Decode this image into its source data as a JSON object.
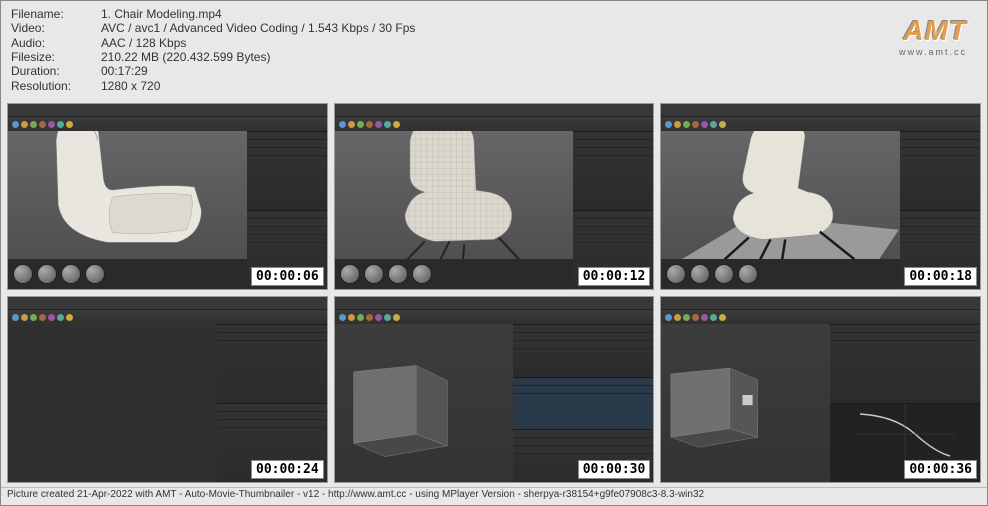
{
  "meta": {
    "filename_label": "Filename:",
    "filename": "1. Chair Modeling.mp4",
    "video_label": "Video:",
    "video": "AVC / avc1 / Advanced Video Coding / 1.543 Kbps / 30 Fps",
    "audio_label": "Audio:",
    "audio": "AAC / 128 Kbps",
    "filesize_label": "Filesize:",
    "filesize": "210.22 MB (220.432.599 Bytes)",
    "duration_label": "Duration:",
    "duration": "00:17:29",
    "resolution_label": "Resolution:",
    "resolution": "1280 x 720"
  },
  "logo": {
    "text": "AMT",
    "sub": "www.amt.cc"
  },
  "thumbs": [
    {
      "tc": "00:00:06"
    },
    {
      "tc": "00:00:12"
    },
    {
      "tc": "00:00:18"
    },
    {
      "tc": "00:00:24"
    },
    {
      "tc": "00:00:30"
    },
    {
      "tc": "00:00:36"
    }
  ],
  "footer": "Picture created 21-Apr-2022 with AMT - Auto-Movie-Thumbnailer - v12 - http://www.amt.cc - using MPlayer Version - sherpya-r38154+g9fe07908c3-8.3-win32"
}
